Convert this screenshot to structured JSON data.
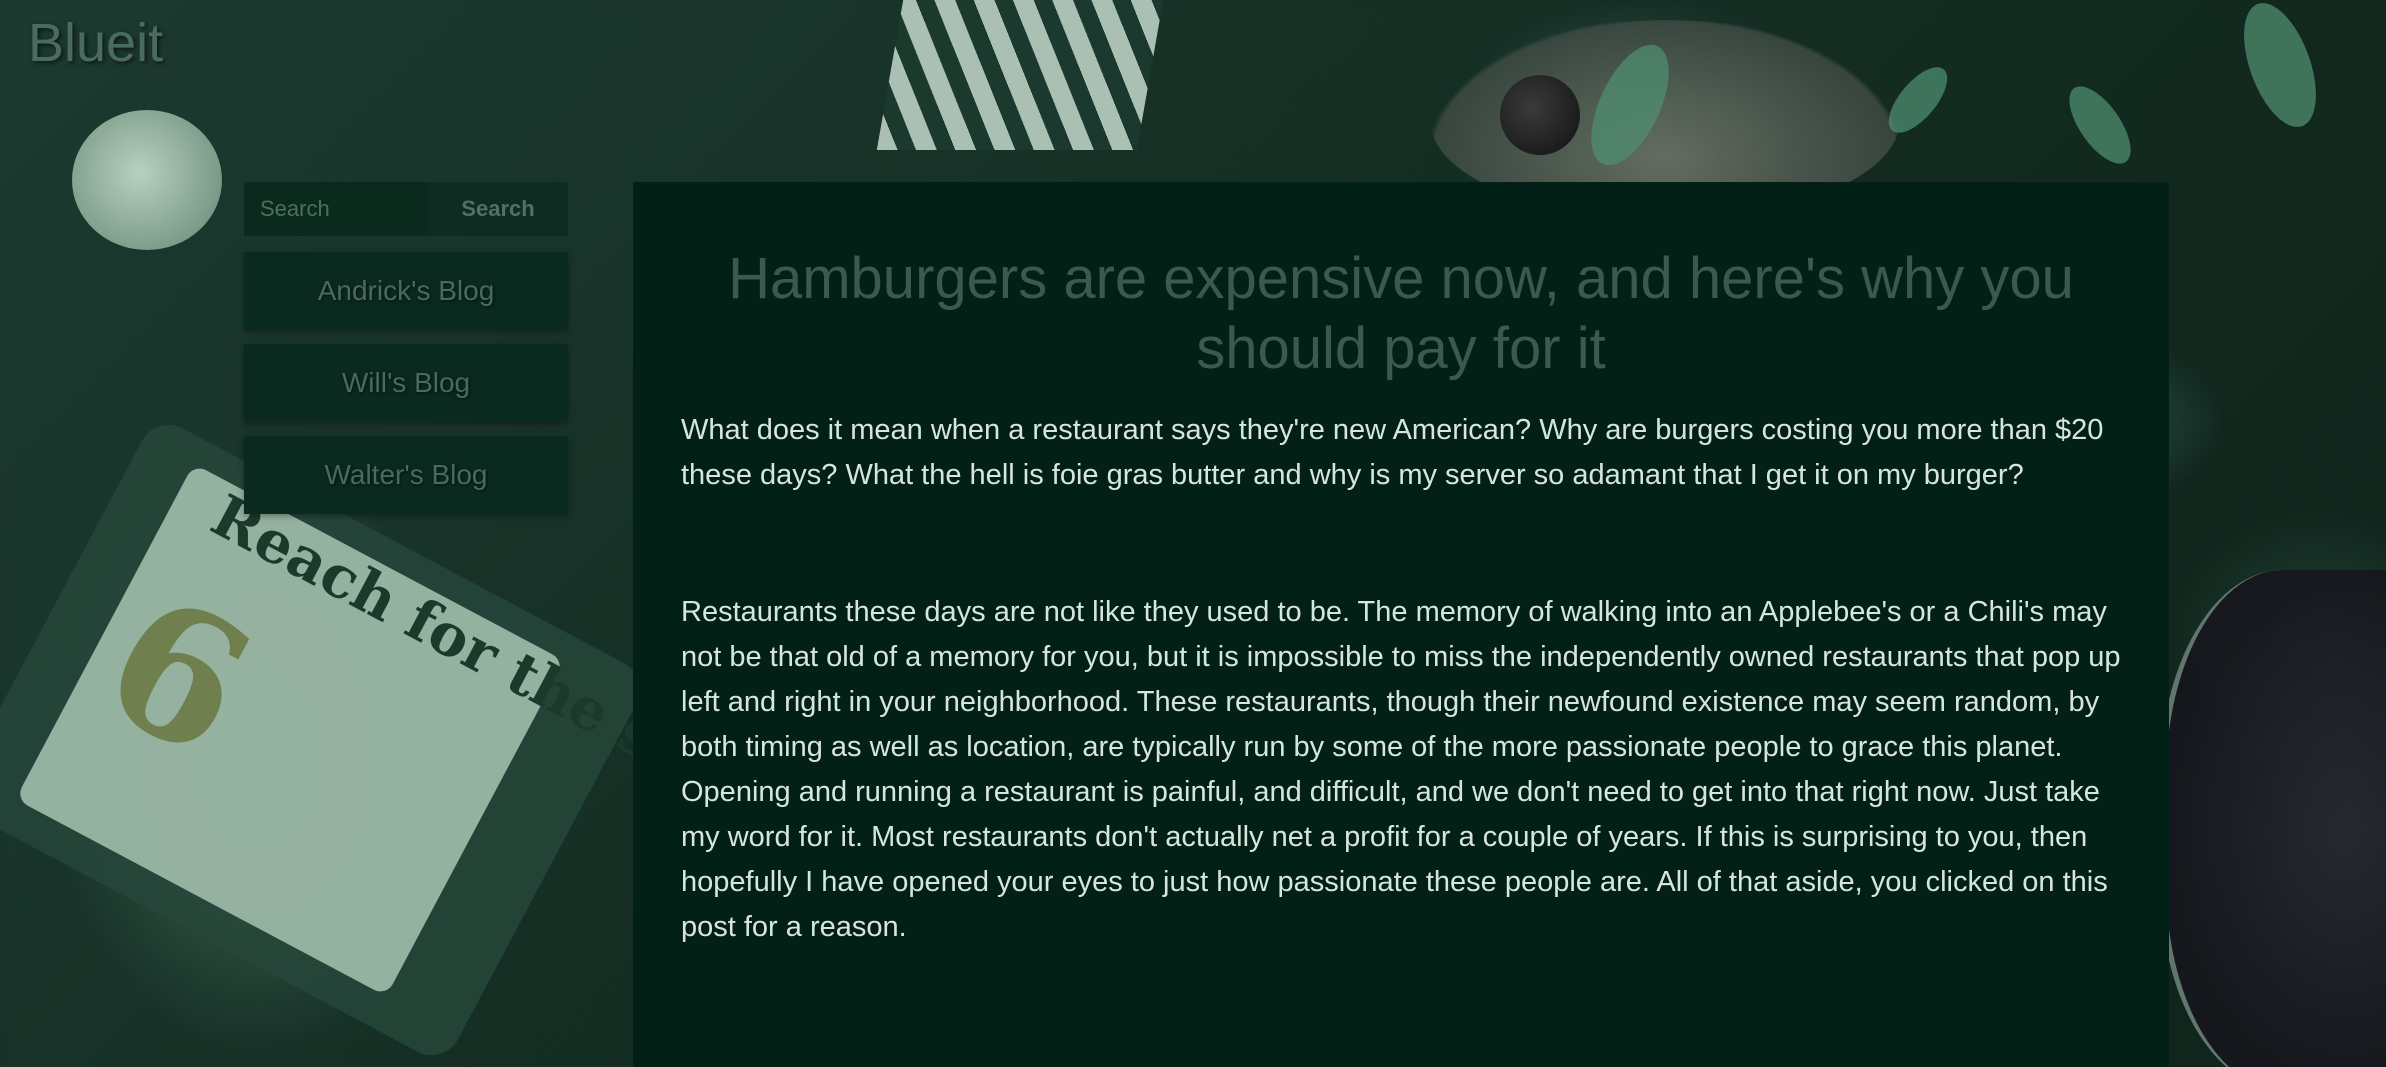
{
  "site": {
    "title": "Blueit"
  },
  "search": {
    "placeholder": "Search",
    "button_label": "Search"
  },
  "sidebar": {
    "items": [
      {
        "label": "Andrick's Blog"
      },
      {
        "label": "Will's Blog"
      },
      {
        "label": "Walter's Blog"
      }
    ]
  },
  "post": {
    "title": "Hamburgers are expensive now, and here's why you should pay for it",
    "paragraphs": [
      "What does it mean when a restaurant says they're new American? Why are burgers costing you more than $20 these days? What the hell is foie gras butter and why is my server so adamant that I get it on my burger?",
      "Restaurants these days are not like they used to be. The memory of walking into an Applebee's or a Chili's may not be that old of a memory for you, but it is impossible to miss the independently owned restaurants that pop up left and right in your neighborhood. These restaurants, though their newfound existence may seem random, by both timing as well as location, are typically run by some of the more passionate people to grace this planet. Opening and running a restaurant is painful, and difficult, and we don't need to get into that right now. Just take my word for it. Most restaurants don't actually net a profit for a couple of years. If this is surprising to you, then hopefully I have opened your eyes to just how passionate these people are. All of that aside, you clicked on this post for a reason."
    ]
  },
  "background": {
    "label_number": "6",
    "label_text": "Reach for the stars"
  }
}
